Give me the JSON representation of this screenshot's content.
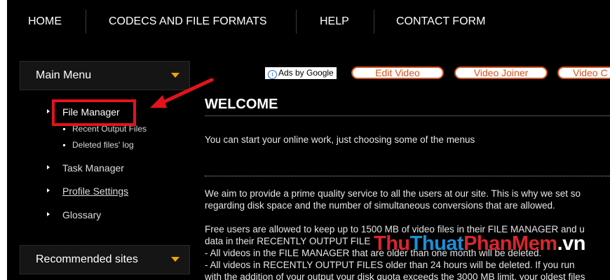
{
  "nav": {
    "items": [
      "HOME",
      "CODECS AND FILE FORMATS",
      "HELP",
      "CONTACT FORM"
    ]
  },
  "sidebar": {
    "main_menu_title": "Main Menu",
    "file_manager": "File Manager",
    "recent_output_files": "Recent Output Files",
    "deleted_files_log": "Deleted files' log",
    "task_manager": "Task Manager",
    "profile_settings": "Profile Settings",
    "glossary": "Glossary",
    "recommended_title": "Recommended sites"
  },
  "ads": {
    "label": "Ads by Google",
    "buttons": [
      "Edit Video",
      "Video Joiner",
      "Video C"
    ]
  },
  "content": {
    "title": "WELCOME",
    "intro": "You can start your online work, just choosing some of the menus",
    "p1_line1": "We aim to provide a prime quality service to all the users at our site. This is why we set so",
    "p1_line2": "regarding disk space and the number of simultaneous conversions that are allowed.",
    "p2_line1": "Free users are allowed to keep up to 1500 MB of video files in their FILE MANAGER and u",
    "p2_line2": "data in their RECENTLY OUTPUT FILE",
    "p2_line3": "- All videos in the FILE MANAGER that are older than one month will be deleted.",
    "p2_line4": "- All videos in RECENTLY OUTPUT FILES older than 24 hours will be deleted. If you run",
    "p2_line5": "with the addition of your output your disk quota exceeds the 3000 MB limit, your oldest files"
  },
  "watermark": {
    "part1": "Thu",
    "part2": "Thuat",
    "part3": "PhanMem",
    "part4": ".vn"
  },
  "colors": {
    "background": "#000000",
    "accent_orange": "#f0a500",
    "highlight_red": "#e3131b",
    "ad_orange": "#d4541f"
  }
}
